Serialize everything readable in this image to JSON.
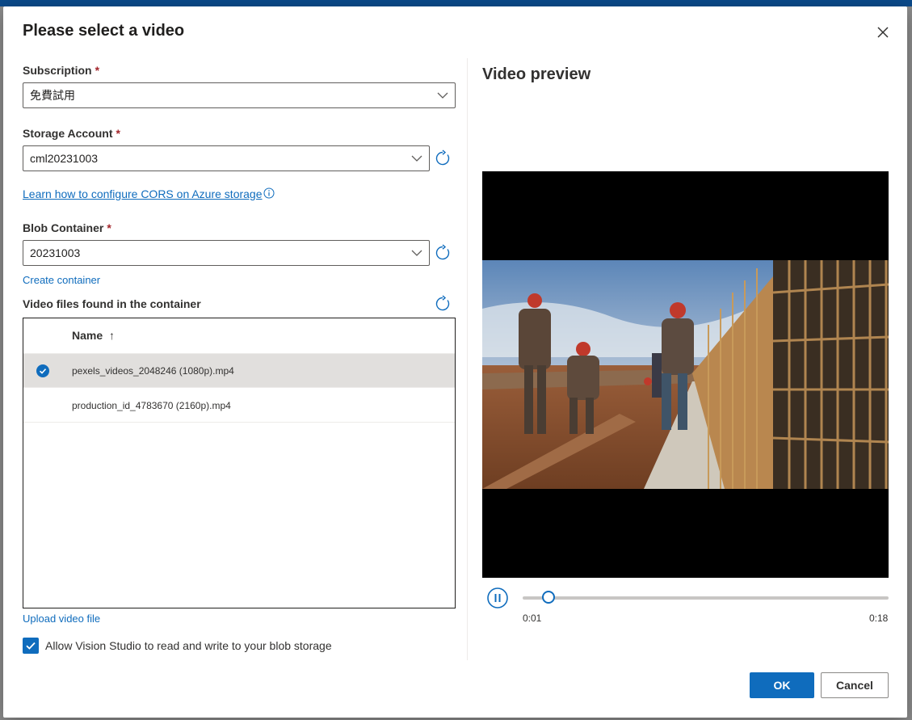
{
  "dialog": {
    "title": "Please select a video",
    "close_icon": "close-icon"
  },
  "subscription": {
    "label": "Subscription",
    "required_mark": "*",
    "value": "免費試用"
  },
  "storage_account": {
    "label": "Storage Account",
    "required_mark": "*",
    "value": "cml20231003"
  },
  "cors_link": {
    "text": "Learn how to configure CORS on Azure storage",
    "icon": "info-icon"
  },
  "blob_container": {
    "label": "Blob Container",
    "required_mark": "*",
    "value": "20231003",
    "create_link": "Create container"
  },
  "video_files": {
    "title": "Video files found in the container",
    "column_name": "Name",
    "sort_indicator": "↑",
    "rows": [
      {
        "name": "pexels_videos_2048246 (1080p).mp4",
        "selected": true
      },
      {
        "name": "production_id_4783670 (2160p).mp4",
        "selected": false
      }
    ]
  },
  "upload_link": "Upload video file",
  "allow_checkbox": {
    "label": "Allow Vision Studio to read and write to your blob storage",
    "checked": true
  },
  "preview": {
    "title": "Video preview",
    "current_time": "0:01",
    "duration": "0:18",
    "progress_fraction": 0.07,
    "state": "playing"
  },
  "buttons": {
    "ok": "OK",
    "cancel": "Cancel"
  },
  "colors": {
    "accent": "#0f6cbd",
    "required": "#a4262c",
    "selected_row": "#e1dfdd"
  }
}
